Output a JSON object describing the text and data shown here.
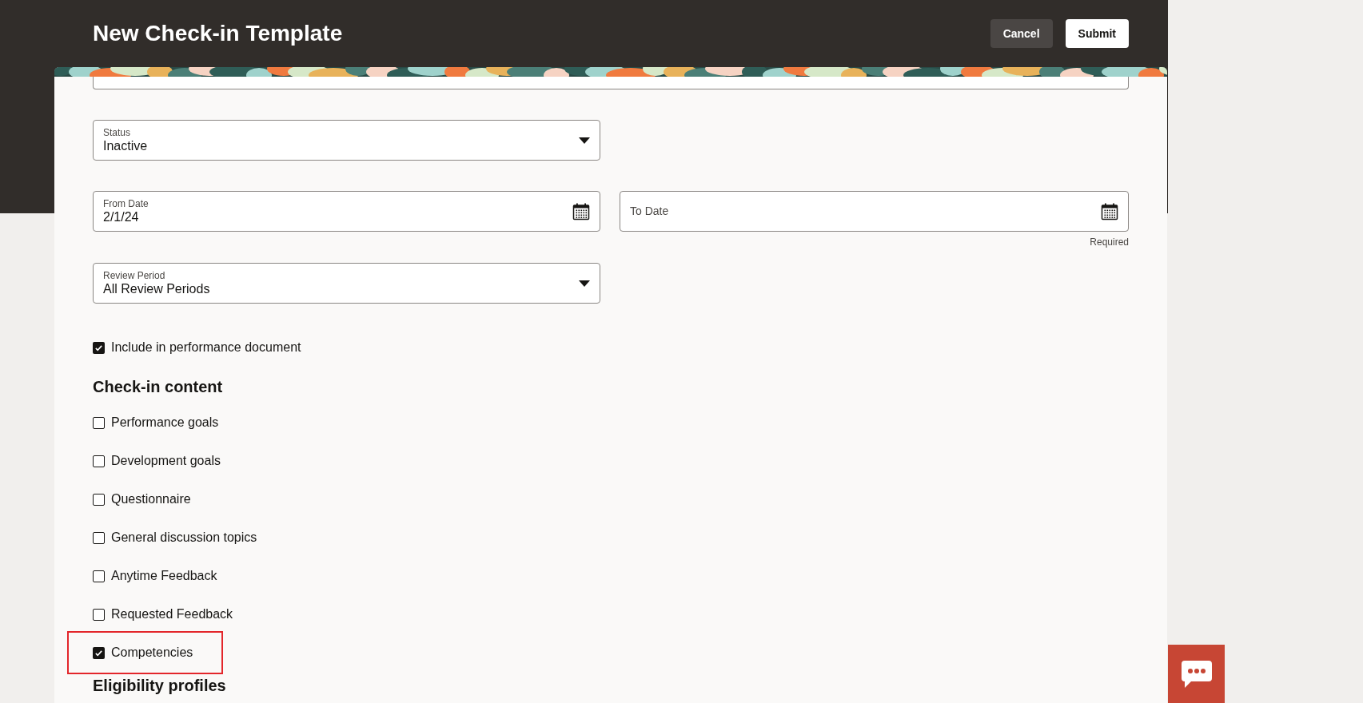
{
  "header": {
    "title": "New Check-in Template",
    "buttons": [
      {
        "label": "Cancel",
        "kind": "secondary"
      },
      {
        "label": "Submit",
        "kind": "primary"
      }
    ]
  },
  "status": {
    "label": "Status",
    "value": "Inactive"
  },
  "from_date": {
    "label": "From Date",
    "value": "2/1/24"
  },
  "to_date": {
    "label": "To Date",
    "hint": "Required"
  },
  "review_period": {
    "label": "Review Period",
    "value": "All Review Periods"
  },
  "include_option": {
    "label": "Include in performance document",
    "checked": true
  },
  "content_section": {
    "title": "Check-in content",
    "options": [
      {
        "label": "Performance goals",
        "checked": false,
        "highlighted": false
      },
      {
        "label": "Development goals",
        "checked": false,
        "highlighted": false
      },
      {
        "label": "Questionnaire",
        "checked": false,
        "highlighted": false
      },
      {
        "label": "General discussion topics",
        "checked": false,
        "highlighted": false
      },
      {
        "label": "Anytime Feedback",
        "checked": false,
        "highlighted": false
      },
      {
        "label": "Requested Feedback",
        "checked": false,
        "highlighted": false
      },
      {
        "label": "Competencies",
        "checked": true,
        "highlighted": true
      }
    ]
  },
  "next_section": {
    "title": "Eligibility profiles"
  }
}
